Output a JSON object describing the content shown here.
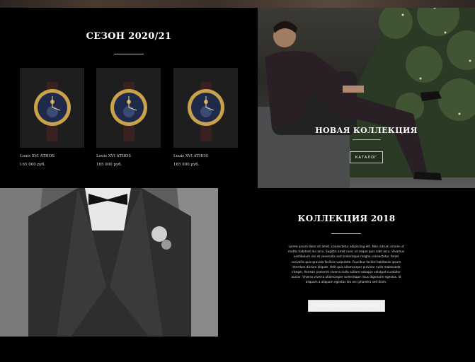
{
  "season": {
    "title": "СЕЗОН 2020/21",
    "products": [
      {
        "name": "Louis XVI ATHOS",
        "price": "165 000 руб."
      },
      {
        "name": "Louis XVI ATHOS",
        "price": "165 000 руб."
      },
      {
        "name": "Louis XVI ATHOS",
        "price": "165 000 руб."
      }
    ]
  },
  "new_collection": {
    "title": "НОВАЯ КОЛЛЕКЦИЯ",
    "button": "КАТАЛОГ"
  },
  "collection_2018": {
    "title": "КОЛЛЕКЦИЯ 2018",
    "text": "Lorem ipsum dolor sit amet, consectetur adipiscing elit. Non rutrum ornare ut mattis habitant dui arcu. Sagittis amet nunc ut neque quis nibh arcu. Vivamus vestibulum nisi et venenatis sed scelerisque magna consectetur. Amet convallis quis gravida facilisis vulputate. Faucibus facilisi habitasse ipsum interdum dictum aliquet. Velit quis ullamcorper pulvinar nulla malesuada integer. Aenean praesent viverra nulla nullam natoque volutpat curabitur auctor. Viverra viverra ullamcorper scelerisque risus dignissim egestas. Id aliquam a aliquam egestas leo orci pharetra sed diam.",
    "button": "ПОСМОТРЕТЬ КОЛЛЕКЦИЮ"
  },
  "colors": {
    "background": "#000000",
    "text": "#ffffff",
    "watch_gold": "#c9a24a",
    "watch_dial": "#1f2a4a",
    "strap": "#3a2020"
  }
}
